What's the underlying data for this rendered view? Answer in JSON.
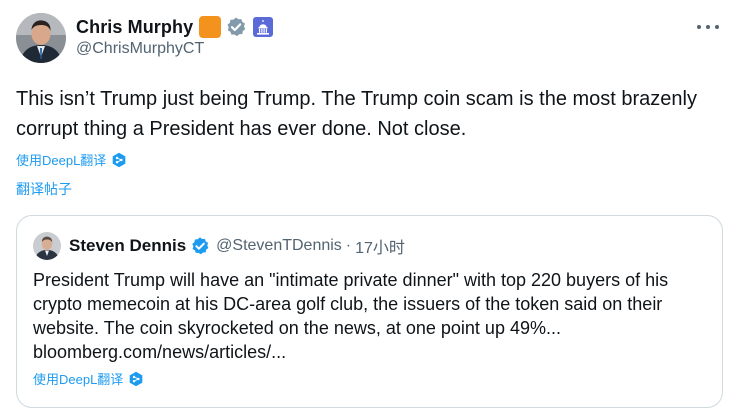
{
  "author": {
    "display_name": "Chris Murphy",
    "handle": "@ChrisMurphyCT"
  },
  "post": {
    "text": "This isn’t Trump just being Trump. The Trump coin scam is the most brazenly corrupt thing a President has ever done. Not close.",
    "translate_deepl_label": "使用DeepL翻译",
    "translate_post_label": "翻译帖子"
  },
  "quote": {
    "display_name": "Steven Dennis",
    "handle": "@StevenTDennis",
    "separator": "·",
    "time": "17小时",
    "text": "President Trump will have an \"intimate private dinner\" with top 220 buyers of his crypto memecoin at his DC-area golf club, the issuers of the token said on their website. The coin skyrocketed on the news, at one point up 49%... bloomberg.com/news/articles/...",
    "translate_deepl_label": "使用DeepL翻译"
  },
  "colors": {
    "link": "#1d9bf0",
    "secondary_text": "#536471",
    "border": "#cfd9de",
    "gold_badge": "#f4921e",
    "verified_gray": "#829aab",
    "verified_blue": "#1d9bf0"
  },
  "icons": [
    "avatar-photo",
    "gold-org-badge",
    "verified-gray-icon",
    "capitol-icon",
    "more-icon",
    "deepl-icon",
    "verified-blue-icon"
  ]
}
